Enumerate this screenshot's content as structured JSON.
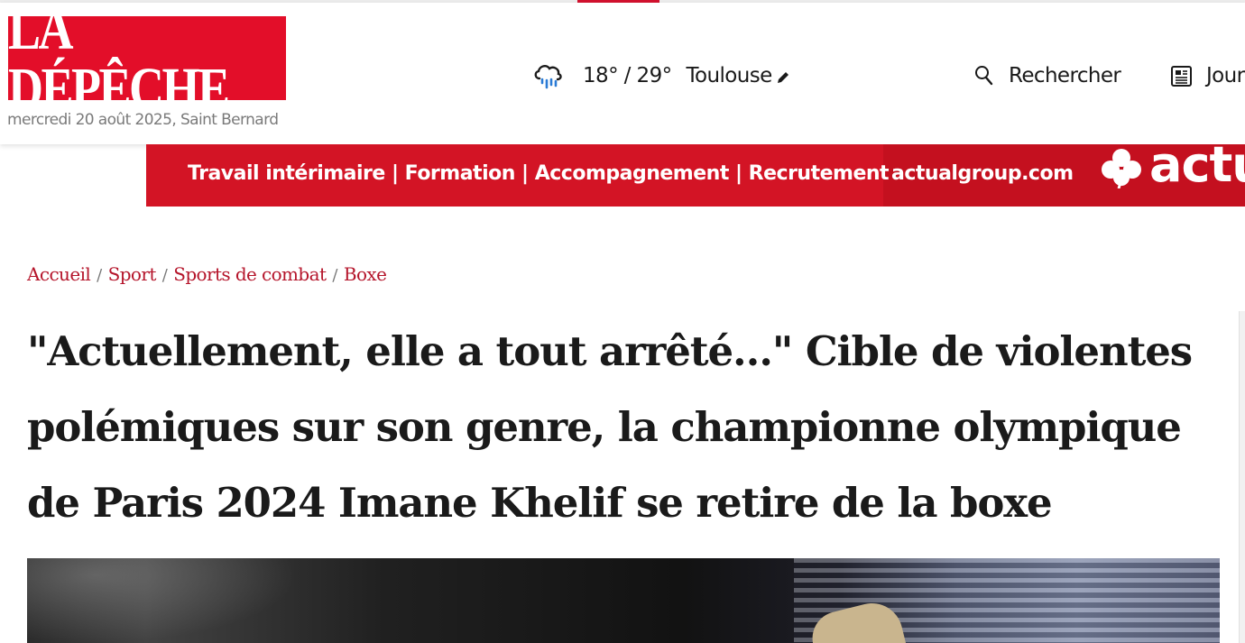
{
  "header": {
    "logo_text": "LA DÉPÊCHE",
    "date_line": "mercredi 20 août 2025, Saint Bernard",
    "weather": {
      "icon": "rain-cloud-icon",
      "temps": "18° / 29°",
      "city": "Toulouse"
    },
    "search_label": "Rechercher",
    "journal_label": "Journal"
  },
  "ad": {
    "text": "Travail intérimaire | Formation | Accompagnement | Recrutement",
    "url": "actualgroup.com",
    "logo_text": "actu"
  },
  "breadcrumb": [
    "Accueil",
    "Sport",
    "Sports de combat",
    "Boxe"
  ],
  "article": {
    "headline": "\"Actuellement, elle a tout arrêté…\" Cible de violentes polémiques sur son genre, la championne olympique de Paris 2024 Imane Khelif se retire de la boxe"
  },
  "colors": {
    "brand_red": "#e30e29",
    "breadcrumb_red": "#b5152b",
    "ad_red": "#d31425"
  }
}
